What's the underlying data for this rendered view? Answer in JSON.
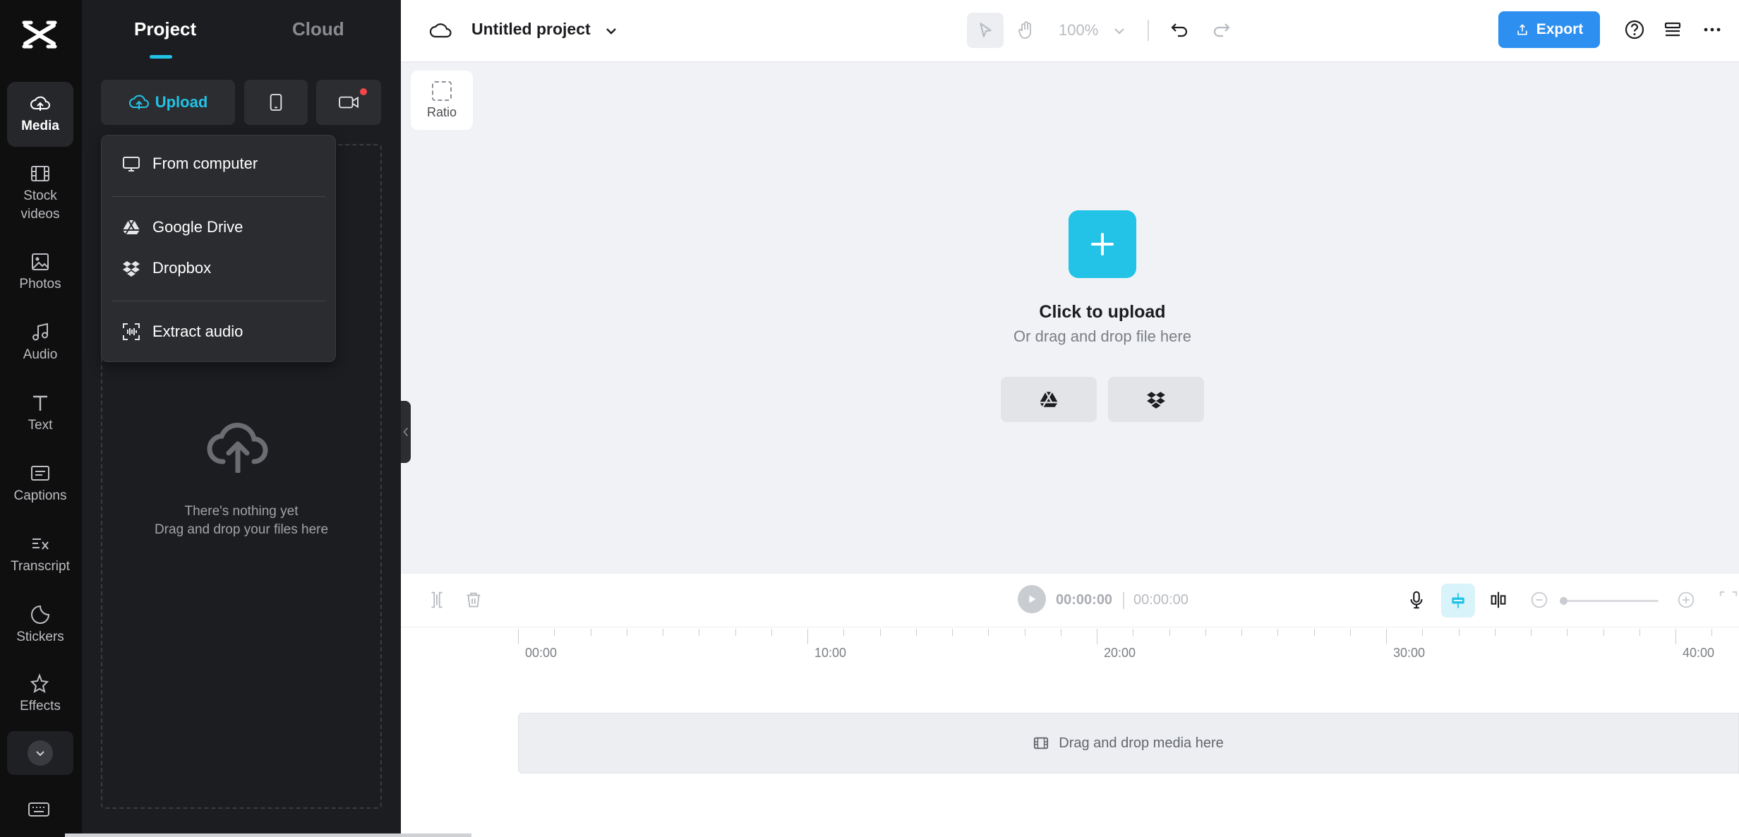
{
  "sidebar": {
    "items": [
      {
        "label": "Media",
        "icon": "cloud-upload-icon",
        "active": true
      },
      {
        "label": "Stock videos",
        "icon": "film-icon"
      },
      {
        "label": "Photos",
        "icon": "image-icon"
      },
      {
        "label": "Audio",
        "icon": "music-note-icon"
      },
      {
        "label": "Text",
        "icon": "text-t-icon"
      },
      {
        "label": "Captions",
        "icon": "captions-icon"
      },
      {
        "label": "Transcript",
        "icon": "transcript-icon"
      },
      {
        "label": "Stickers",
        "icon": "sticker-icon"
      },
      {
        "label": "Effects",
        "icon": "sparkle-icon"
      }
    ]
  },
  "panel": {
    "tabs": [
      {
        "label": "Project",
        "active": true
      },
      {
        "label": "Cloud"
      }
    ],
    "upload_label": "Upload",
    "empty_line1": "There's nothing yet",
    "empty_line2": "Drag and drop your files here"
  },
  "upload_menu": {
    "items": [
      {
        "label": "From computer",
        "icon": "monitor-icon"
      },
      {
        "label": "Google Drive",
        "icon": "google-drive-icon"
      },
      {
        "label": "Dropbox",
        "icon": "dropbox-icon"
      },
      {
        "label": "Extract audio",
        "icon": "extract-audio-icon"
      }
    ]
  },
  "topbar": {
    "project_name": "Untitled project",
    "zoom": "100%",
    "export_label": "Export"
  },
  "canvas": {
    "ratio_label": "Ratio",
    "upload_title": "Click to upload",
    "upload_subtitle": "Or drag and drop file here"
  },
  "timeline": {
    "current_time": "00:00:00",
    "total_time": "00:00:00",
    "ruler_labels": [
      "00:00",
      "10:00",
      "20:00",
      "30:00",
      "40:00"
    ],
    "drop_hint": "Drag and drop media here"
  },
  "colors": {
    "accent": "#22c3e6",
    "export": "#2d8ff0",
    "rail_bg": "#0f0f10",
    "panel_bg": "#1c1d20"
  }
}
